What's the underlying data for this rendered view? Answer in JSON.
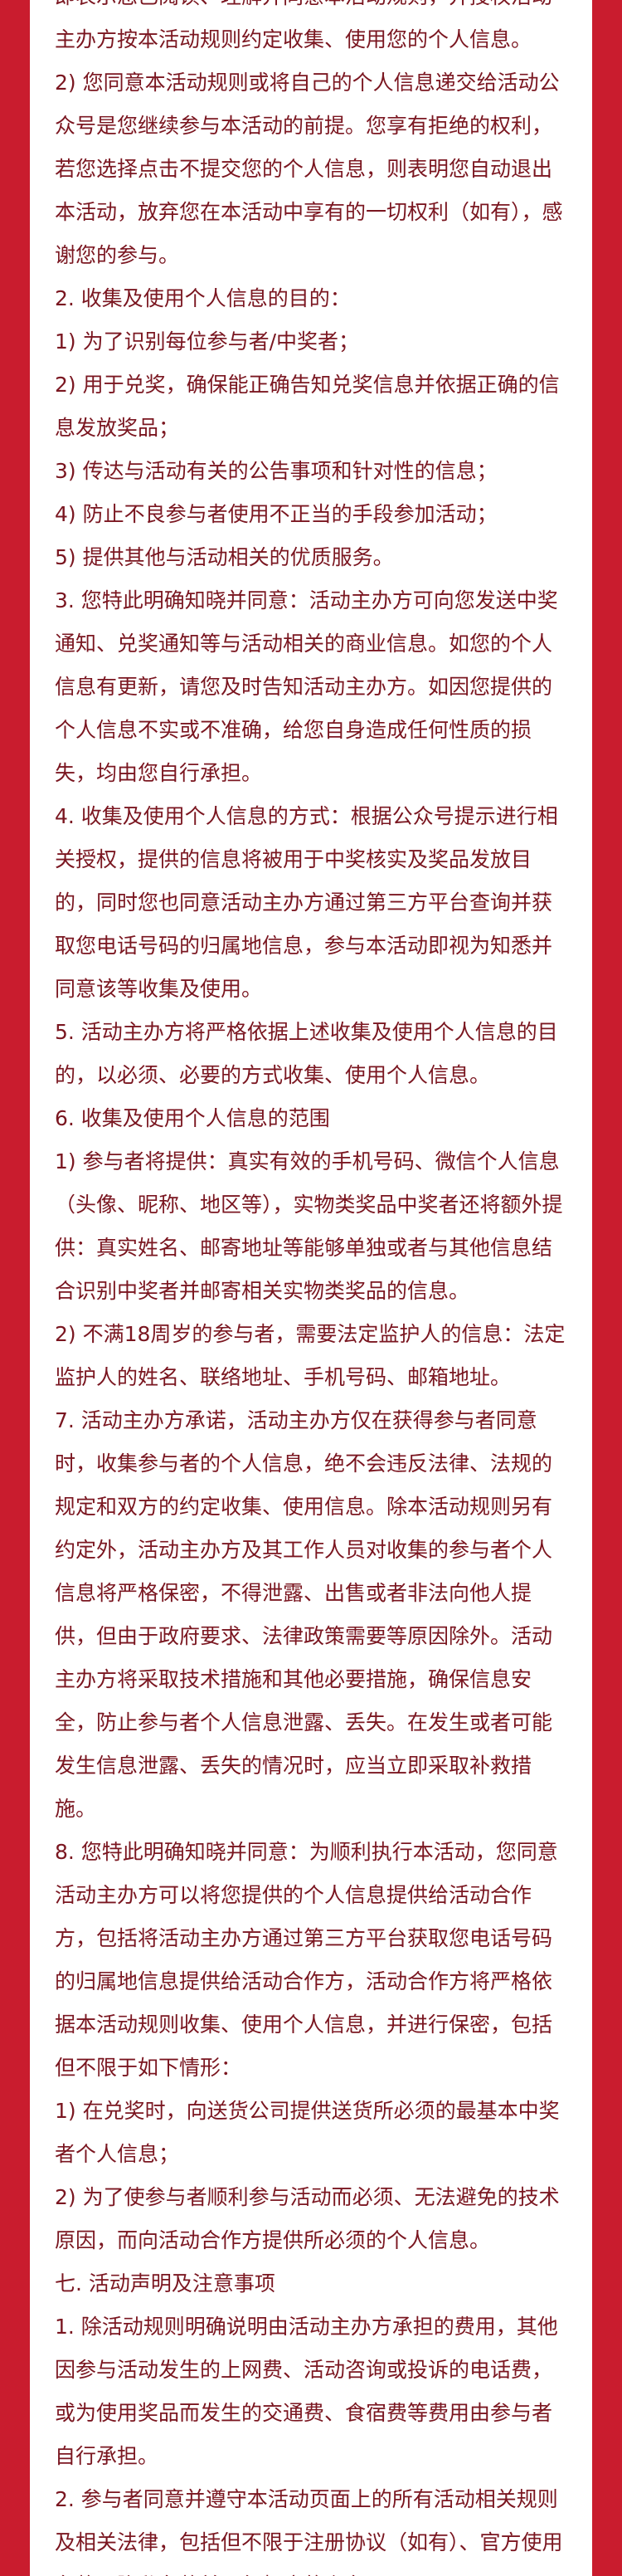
{
  "paragraphs": [
    "即表示您已阅读、理解并同意本活动规则，并授权活动主办方按本活动规则约定收集、使用您的个人信息。",
    "2) 您同意本活动规则或将自己的个人信息递交给活动公众号是您继续参与本活动的前提。您享有拒绝的权利，若您选择点击不提交您的个人信息，则表明您自动退出本活动，放弃您在本活动中享有的一切权利（如有），感谢您的参与。",
    "2. 收集及使用个人信息的目的：",
    "1) 为了识别每位参与者/中奖者；",
    "2) 用于兑奖，确保能正确告知兑奖信息并依据正确的信息发放奖品；",
    "3) 传达与活动有关的公告事项和针对性的信息；",
    "4) 防止不良参与者使用不正当的手段参加活动；",
    "5) 提供其他与活动相关的优质服务。",
    "3. 您特此明确知晓并同意：活动主办方可向您发送中奖通知、兑奖通知等与活动相关的商业信息。如您的个人信息有更新，请您及时告知活动主办方。如因您提供的个人信息不实或不准确，给您自身造成任何性质的损失，均由您自行承担。",
    "4. 收集及使用个人信息的方式：根据公众号提示进行相关授权，提供的信息将被用于中奖核实及奖品发放目的，同时您也同意活动主办方通过第三方平台查询并获取您电话号码的归属地信息，参与本活动即视为知悉并同意该等收集及使用。",
    "5. 活动主办方将严格依据上述收集及使用个人信息的目的，以必须、必要的方式收集、使用个人信息。",
    "6. 收集及使用个人信息的范围",
    "1) 参与者将提供：真实有效的手机号码、微信个人信息（头像、昵称、地区等），实物类奖品中奖者还将额外提供：真实姓名、邮寄地址等能够单独或者与其他信息结合识别中奖者并邮寄相关实物类奖品的信息。",
    "2) 不满18周岁的参与者，需要法定监护人的信息：法定监护人的姓名、联络地址、手机号码、邮箱地址。",
    "7. 活动主办方承诺，活动主办方仅在获得参与者同意时，收集参与者的个人信息，绝不会违反法律、法规的规定和双方的约定收集、使用信息。除本活动规则另有约定外，活动主办方及其工作人员对收集的参与者个人信息将严格保密，不得泄露、出售或者非法向他人提供，但由于政府要求、法律政策需要等原因除外。活动主办方将采取技术措施和其他必要措施，确保信息安全，防止参与者个人信息泄露、丢失。在发生或者可能发生信息泄露、丢失的情况时，应当立即采取补救措施。",
    "8. 您特此明确知晓并同意：为顺利执行本活动，您同意活动主办方可以将您提供的个人信息提供给活动合作方，包括将活动主办方通过第三方平台获取您电话号码的归属地信息提供给活动合作方，活动合作方将严格依据本活动规则收集、使用个人信息，并进行保密，包括但不限于如下情形：",
    "1) 在兑奖时，向送货公司提供送货所必须的最基本中奖者个人信息；",
    "2) 为了使参与者顺利参与活动而必须、无法避免的技术原因，而向活动合作方提供所必须的个人信息。",
    "七. 活动声明及注意事项",
    "1. 除活动规则明确说明由活动主办方承担的费用，其他因参与活动发生的上网费、活动咨询或投诉的电话费，或为使用奖品而发生的交通费、食宿费等费用由参与者自行承担。",
    "2. 参与者同意并遵守本活动页面上的所有活动相关规则及相关法律，包括但不限于注册协议（如有）、官方使用条款及隐私条款并履行相应的义务。"
  ]
}
